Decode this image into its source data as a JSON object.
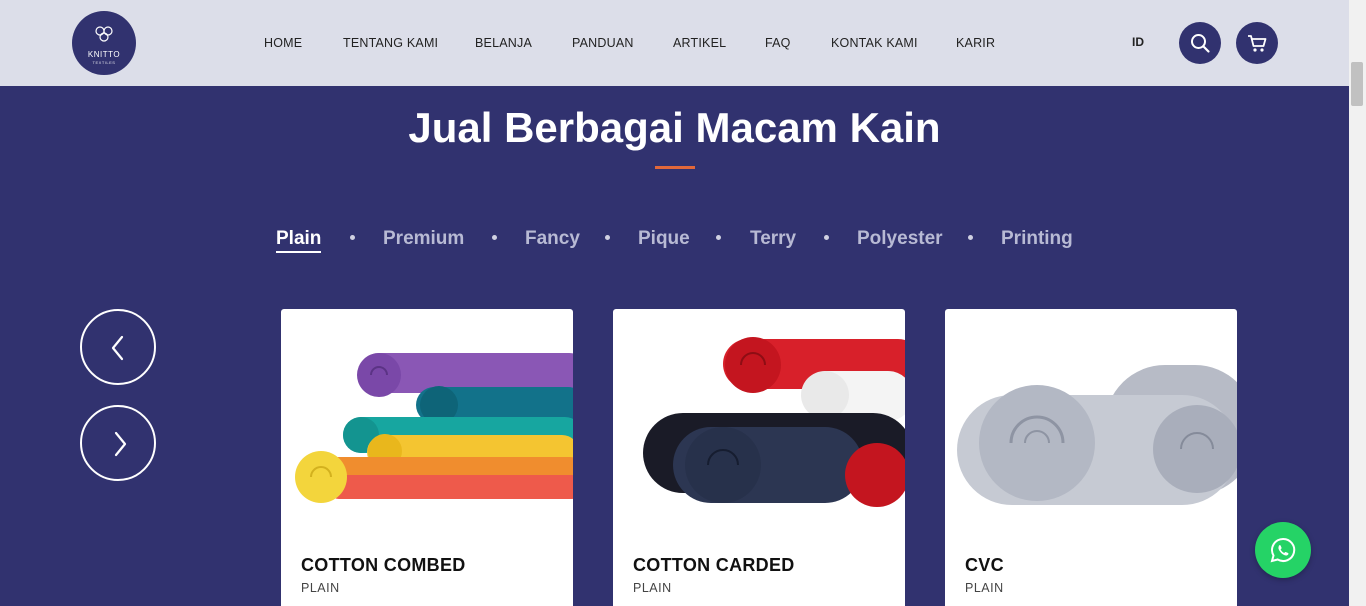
{
  "header": {
    "logo": {
      "brand": "KNITTO",
      "sub": "TEXTILES"
    },
    "nav": [
      "HOME",
      "TENTANG KAMI",
      "BELANJA",
      "PANDUAN",
      "ARTIKEL",
      "FAQ",
      "KONTAK KAMI",
      "KARIR"
    ],
    "language": "ID",
    "icons": {
      "search": "search-icon",
      "cart": "cart-icon"
    }
  },
  "section": {
    "title": "Jual Berbagai Macam Kain",
    "tabs": [
      "Plain",
      "Premium",
      "Fancy",
      "Pique",
      "Terry",
      "Polyester",
      "Printing"
    ],
    "active_tab": "Plain"
  },
  "carousel": {
    "prev_icon": "chevron-left-icon",
    "next_icon": "chevron-right-icon"
  },
  "products": [
    {
      "name": "COTTON COMBED",
      "category": "PLAIN"
    },
    {
      "name": "COTTON CARDED",
      "category": "PLAIN"
    },
    {
      "name": "CVC",
      "category": "PLAIN"
    }
  ],
  "whatsapp": {
    "icon": "whatsapp-icon"
  },
  "colors": {
    "primary": "#31326f",
    "header_bg": "#dcdee9",
    "accent": "#e2683a",
    "whatsapp": "#25d366"
  }
}
